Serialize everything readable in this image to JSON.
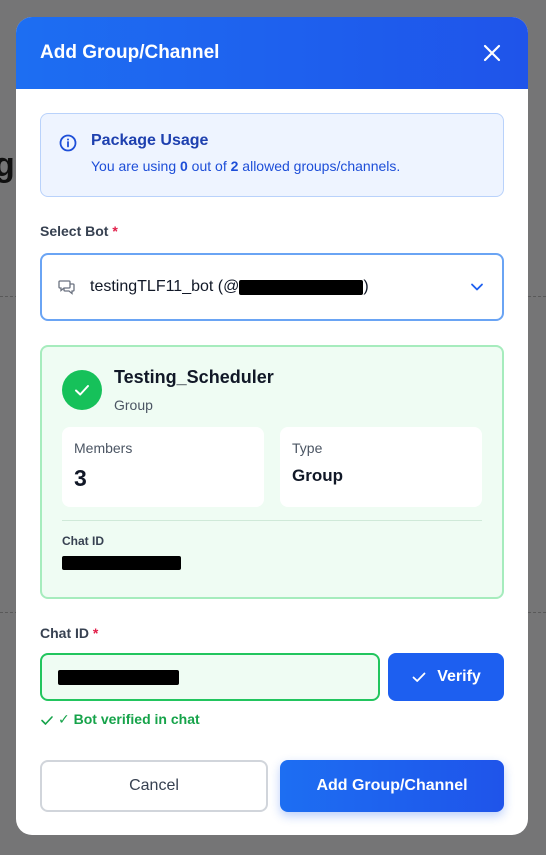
{
  "background": {
    "partial_heading": "g"
  },
  "modal": {
    "title": "Add Group/Channel",
    "close_icon": "close-icon"
  },
  "usage": {
    "title": "Package Usage",
    "text_prefix": "You are using ",
    "used": "0",
    "text_mid": " out of ",
    "allowed": "2",
    "text_suffix": " allowed groups/channels."
  },
  "bot": {
    "label": "Select Bot",
    "required_mark": "*",
    "selected_prefix": "testingTLF11_bot (@",
    "selected_suffix": ")"
  },
  "chat": {
    "name": "Testing_Scheduler",
    "kind": "Group",
    "members_label": "Members",
    "members_value": "3",
    "type_label": "Type",
    "type_value": "Group",
    "chat_id_label": "Chat ID"
  },
  "chat_id_field": {
    "label": "Chat ID",
    "required_mark": "*",
    "verify_label": "Verify",
    "verified_text": "✓ Bot verified in chat"
  },
  "footer": {
    "cancel_label": "Cancel",
    "submit_label": "Add Group/Channel"
  },
  "colors": {
    "primary": "#1d5ff0",
    "success": "#16c15a",
    "info_bg": "#eef4ff",
    "success_bg": "#effcf3"
  }
}
